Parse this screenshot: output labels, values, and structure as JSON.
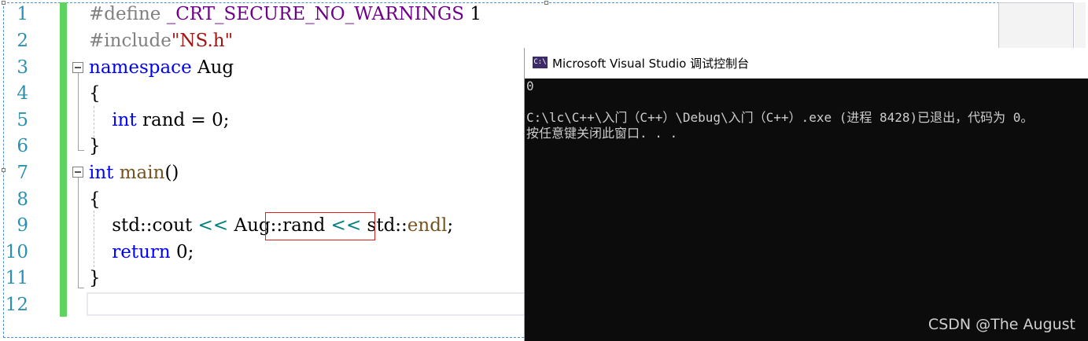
{
  "editor": {
    "lines": [
      {
        "num": "1",
        "parts": [
          {
            "t": "#define ",
            "c": "pp"
          },
          {
            "t": "_CRT_SECURE_NO_WARNINGS",
            "c": "macro"
          },
          {
            "t": " 1",
            "c": ""
          }
        ]
      },
      {
        "num": "2",
        "parts": [
          {
            "t": "#include",
            "c": "pp"
          },
          {
            "t": "\"NS.h\"",
            "c": "str"
          }
        ]
      },
      {
        "num": "3",
        "parts": [
          {
            "t": "namespace",
            "c": "kw"
          },
          {
            "t": " Aug",
            "c": ""
          }
        ]
      },
      {
        "num": "4",
        "parts": [
          {
            "t": "{",
            "c": ""
          }
        ]
      },
      {
        "num": "5",
        "parts": [
          {
            "t": "    ",
            "c": ""
          },
          {
            "t": "int",
            "c": "kw"
          },
          {
            "t": " rand = 0;",
            "c": ""
          }
        ]
      },
      {
        "num": "6",
        "parts": [
          {
            "t": "}",
            "c": ""
          }
        ]
      },
      {
        "num": "7",
        "parts": [
          {
            "t": "int",
            "c": "kw"
          },
          {
            "t": " ",
            "c": ""
          },
          {
            "t": "main",
            "c": "fn"
          },
          {
            "t": "()",
            "c": ""
          }
        ]
      },
      {
        "num": "8",
        "parts": [
          {
            "t": "{",
            "c": ""
          }
        ]
      },
      {
        "num": "9",
        "parts": [
          {
            "t": "    std::cout ",
            "c": ""
          },
          {
            "t": "<<",
            "c": "op"
          },
          {
            "t": " Aug::rand ",
            "c": ""
          },
          {
            "t": "<<",
            "c": "op"
          },
          {
            "t": " std::",
            "c": ""
          },
          {
            "t": "endl",
            "c": "fn"
          },
          {
            "t": ";",
            "c": ""
          }
        ]
      },
      {
        "num": "10",
        "parts": [
          {
            "t": "    ",
            "c": ""
          },
          {
            "t": "return",
            "c": "kw"
          },
          {
            "t": " 0;",
            "c": ""
          }
        ]
      },
      {
        "num": "11",
        "parts": [
          {
            "t": "}",
            "c": ""
          }
        ]
      },
      {
        "num": "12",
        "parts": []
      }
    ]
  },
  "console": {
    "title": "Microsoft Visual Studio 调试控制台",
    "icon": "visual-studio-console-icon",
    "icon_label": "C:\\",
    "output": [
      "0",
      "",
      "C:\\lc\\C++\\入门（C++）\\Debug\\入门（C++）.exe (进程 8428)已退出，代码为 0。",
      "按任意键关闭此窗口. . ."
    ]
  },
  "watermark": "CSDN @The   August",
  "colors": {
    "keyword": "#0000ff",
    "preprocessor": "#808080",
    "macro": "#6f008a",
    "string": "#a31515",
    "function": "#74531f",
    "line_number": "#2b91af",
    "change_marker": "#5fd35f",
    "console_bg": "#0c0c0c",
    "highlight_box": "#e02020"
  }
}
